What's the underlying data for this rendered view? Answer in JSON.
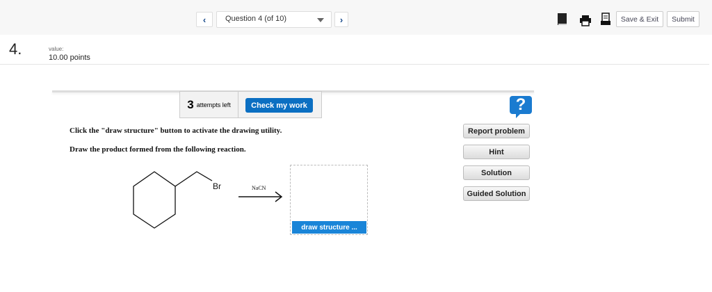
{
  "nav": {
    "prev_label": "‹",
    "next_label": "›",
    "question_select": "Question 4 (of 10)"
  },
  "toolbar": {
    "save_exit": "Save & Exit",
    "submit": "Submit",
    "icons": [
      "ebook-icon",
      "print-icon",
      "calculator-icon"
    ]
  },
  "question": {
    "number": "4.",
    "value_label": "value:",
    "points": "10.00 points"
  },
  "attempts": {
    "count": "3",
    "label": "attempts left",
    "check_button": "Check my work"
  },
  "help": {
    "icon": "?"
  },
  "instructions": [
    "Click the \"draw structure\" button to activate the drawing utility.",
    "Draw the product formed from the following reaction."
  ],
  "reaction": {
    "leaving_group": "Br",
    "reagent": "NaCN"
  },
  "draw_button": "draw structure ...",
  "side_buttons": [
    "Report problem",
    "Hint",
    "Solution",
    "Guided Solution"
  ],
  "colors": {
    "accent": "#1a7bd0",
    "check": "#0b6fc2"
  }
}
